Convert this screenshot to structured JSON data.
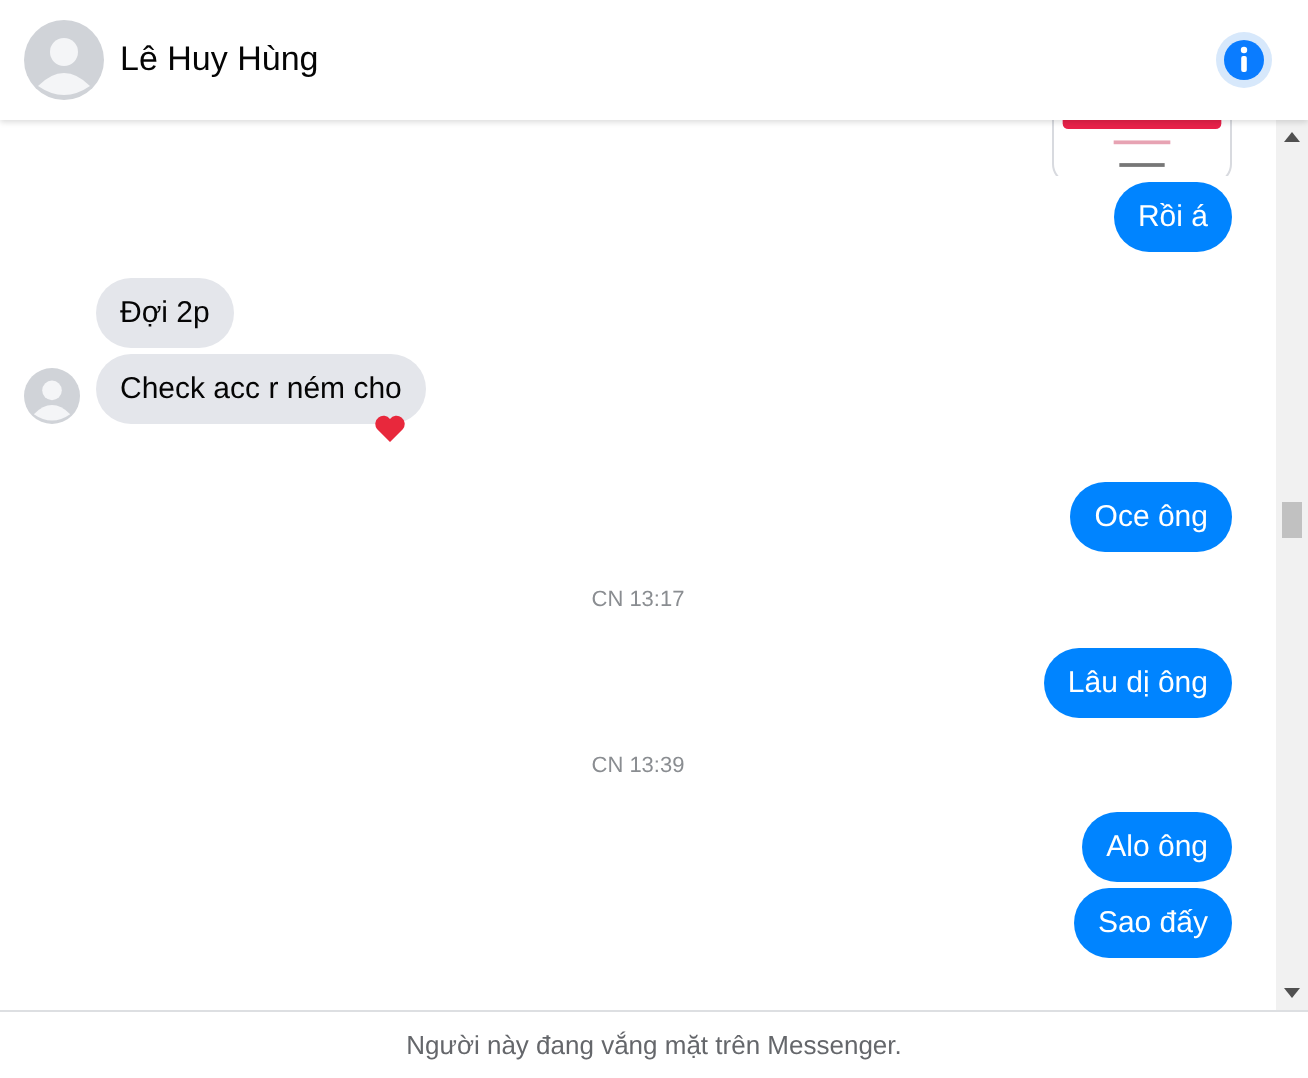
{
  "header": {
    "contact_name": "Lê Huy Hùng"
  },
  "messages": [
    {
      "kind": "picture"
    },
    {
      "kind": "sent",
      "text": "Rồi á"
    },
    {
      "kind": "received",
      "text": "Đợi 2p",
      "avatar": false,
      "reaction": false
    },
    {
      "kind": "received",
      "text": "Check acc r ném cho",
      "avatar": true,
      "reaction": true
    },
    {
      "kind": "sent",
      "text": "Oce ông"
    },
    {
      "kind": "time",
      "text": "CN 13:17"
    },
    {
      "kind": "sent",
      "text": "Lâu dị ông"
    },
    {
      "kind": "time",
      "text": "CN 13:39"
    },
    {
      "kind": "sent",
      "text": "Alo ông"
    },
    {
      "kind": "sent",
      "text": "Sao đấy"
    }
  ],
  "footer": {
    "status": "Người này đang vắng mặt trên Messenger."
  }
}
